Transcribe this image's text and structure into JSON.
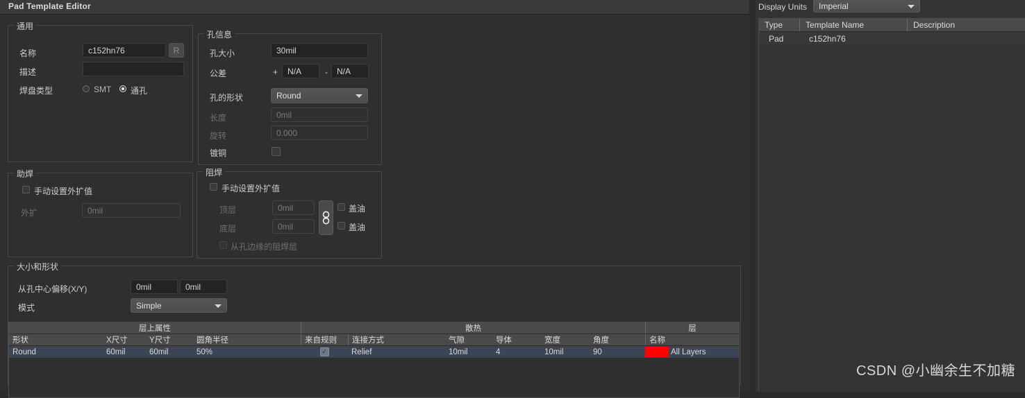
{
  "window": {
    "title": "Pad Template Editor"
  },
  "general": {
    "legend": "通用",
    "name_label": "名称",
    "name_value": "c152hn76",
    "reset_button": "R",
    "desc_label": "描述",
    "desc_value": "",
    "pad_type_label": "焊盘类型",
    "smt_label": "SMT",
    "through_label": "通孔",
    "selected_type": "通孔"
  },
  "hole": {
    "legend": "孔信息",
    "size_label": "孔大小",
    "size_value": "30mil",
    "tolerance_label": "公差",
    "plus_sign": "+",
    "minus_sign": "-",
    "tol_plus": "N/A",
    "tol_minus": "N/A",
    "shape_label": "孔的形状",
    "shape_value": "Round",
    "length_label": "长度",
    "length_value": "0mil",
    "rotation_label": "旋转",
    "rotation_value": "0.000",
    "plated_label": "镀铜",
    "plated_checked": false
  },
  "paste": {
    "legend": "助焊",
    "manual_label": "手动设置外扩值",
    "manual_checked": false,
    "expansion_label": "外扩",
    "expansion_value": "0mil"
  },
  "solder": {
    "legend": "阻焊",
    "manual_label": "手动设置外扩值",
    "manual_checked": false,
    "top_label": "顶层",
    "top_value": "0mil",
    "bottom_label": "底层",
    "bottom_value": "0mil",
    "top_tent_label": "盖油",
    "bottom_tent_label": "盖油",
    "top_tent_checked": false,
    "bottom_tent_checked": false,
    "from_hole_label": "从孔边缘的阻焊层",
    "from_hole_checked": false,
    "link_icon": "link-icon"
  },
  "size_shape": {
    "legend": "大小和形状",
    "offset_label": "从孔中心偏移(X/Y)",
    "offset_x": "0mil",
    "offset_y": "0mil",
    "mode_label": "模式",
    "mode_value": "Simple"
  },
  "grid": {
    "group_headers": [
      "层上属性",
      "散热",
      "层"
    ],
    "columns": [
      "形状",
      "X尺寸",
      "Y尺寸",
      "圆角半径",
      "来自规则",
      "连接方式",
      "气隙",
      "导体",
      "宽度",
      "角度",
      "名称"
    ],
    "rows": [
      {
        "shape": "Round",
        "x_size": "60mil",
        "y_size": "60mil",
        "corner_radius": "50%",
        "from_rule_checked": true,
        "connect_style": "Relief",
        "air_gap": "10mil",
        "conductors": "4",
        "width": "10mil",
        "angle": "90",
        "layer_color": "#ff0000",
        "layer_name": "All Layers"
      }
    ]
  },
  "right_panel": {
    "display_units_label": "Display Units",
    "display_units_value": "Imperial",
    "columns": [
      "Type",
      "Template Name",
      "Description"
    ],
    "rows": [
      {
        "type": "Pad",
        "template_name": "c152hn76",
        "description": ""
      }
    ]
  },
  "watermark": {
    "text": "CSDN @小幽余生不加糖"
  }
}
